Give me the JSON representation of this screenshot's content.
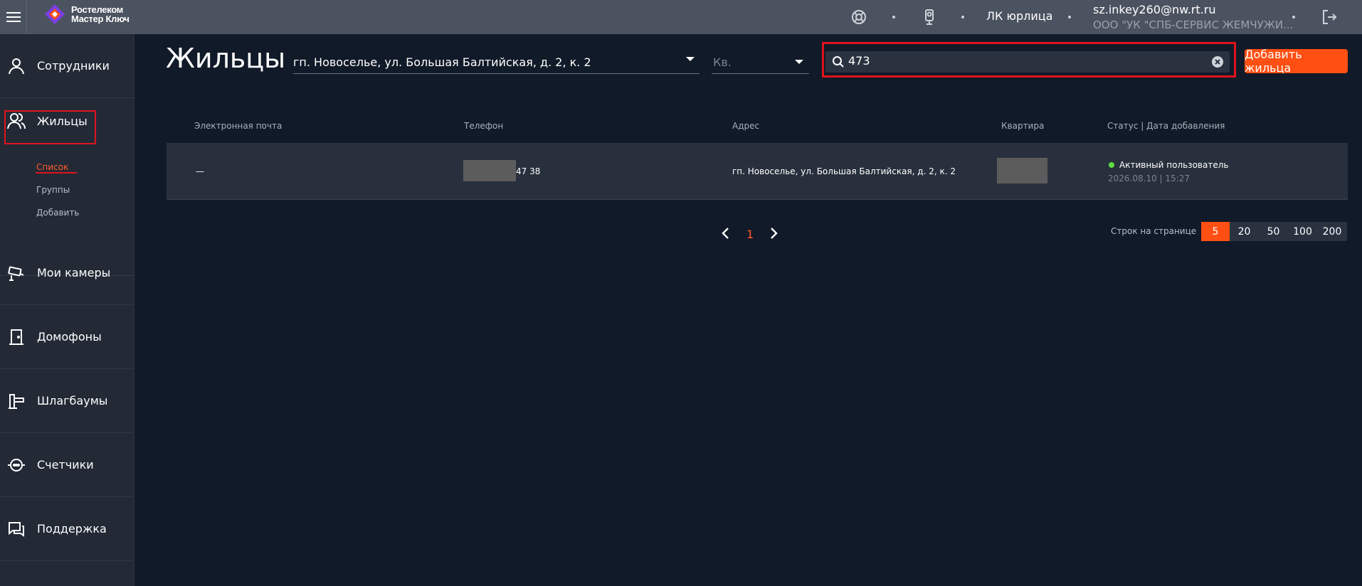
{
  "topbar": {
    "logo_line1": "Ростелеком",
    "logo_line2": "Мастер Ключ",
    "account_type": "ЛК юрлица",
    "user_email": "sz.inkey260@nw.rt.ru",
    "company": "ООО \"УК \"СПБ-СЕРВИС ЖЕМЧУЖИ..."
  },
  "sidebar": {
    "items": [
      {
        "label": "Сотрудники",
        "icon": "person-icon"
      },
      {
        "label": "Жильцы",
        "icon": "residents-icon"
      },
      {
        "label": "Мои камеры",
        "icon": "camera-icon"
      },
      {
        "label": "Домофоны",
        "icon": "door-icon"
      },
      {
        "label": "Шлагбаумы",
        "icon": "barrier-icon"
      },
      {
        "label": "Счетчики",
        "icon": "meter-icon"
      },
      {
        "label": "Поддержка",
        "icon": "chat-icon"
      }
    ],
    "submenu": [
      "Список",
      "Группы",
      "Добавить"
    ]
  },
  "header": {
    "title": "Жильцы",
    "address_value": "гп. Новоселье, ул. Большая Балтийская, д. 2, к. 2",
    "apartment_placeholder": "Кв.",
    "search_value": "473",
    "add_button": "Добавить жильца"
  },
  "table": {
    "columns": [
      "Электронная почта",
      "Телефон",
      "Адрес",
      "Квартира",
      "Статус | Дата добавления"
    ],
    "rows": [
      {
        "email": "—",
        "phone_suffix": "47 38",
        "address": "гп. Новоселье, ул. Большая Балтийская, д. 2, к. 2",
        "status": "Активный пользователь",
        "date": "2026.08.10 | 15:27"
      }
    ]
  },
  "pagination": {
    "current_page": "1",
    "rows_label": "Строк на странице",
    "rows_options": [
      "5",
      "20",
      "50",
      "100",
      "200"
    ],
    "rows_selected": "5"
  },
  "colors": {
    "accent": "#ff4f12",
    "highlight_box": "#e0131c",
    "status_active": "#5fdc3e",
    "background": "#111a28",
    "sidebar": "#232a36"
  }
}
